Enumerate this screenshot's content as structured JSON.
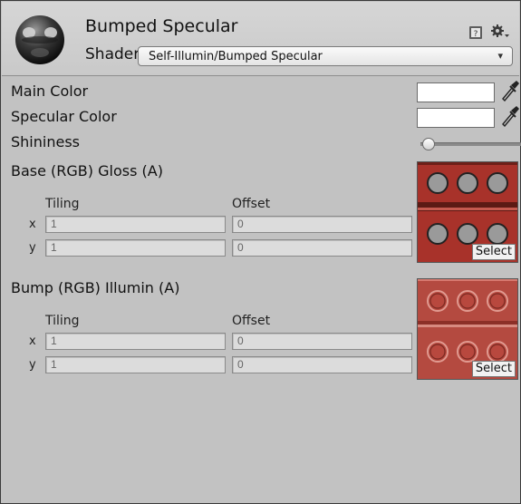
{
  "header": {
    "material_name": "Bumped Specular",
    "shader_label": "Shader",
    "shader_value": "Self-Illumin/Bumped Specular",
    "dropdown_arrow": "▾",
    "icons": [
      "material-sphere-icon",
      "help-book-icon",
      "gear-icon"
    ]
  },
  "properties": {
    "main_color": {
      "label": "Main Color",
      "value": "#ffffff"
    },
    "specular_color": {
      "label": "Specular Color",
      "value": "#ffffff"
    },
    "shininess": {
      "label": "Shininess",
      "value": 0.03
    },
    "base_texture": {
      "label": "Base (RGB) Gloss (A)",
      "tiling_label": "Tiling",
      "offset_label": "Offset",
      "x_label": "x",
      "y_label": "y",
      "tiling_x": "1",
      "tiling_y": "1",
      "offset_x": "0",
      "offset_y": "0",
      "select_label": "Select"
    },
    "bump_texture": {
      "label": "Bump (RGB) Illumin (A)",
      "tiling_label": "Tiling",
      "offset_label": "Offset",
      "x_label": "x",
      "y_label": "y",
      "tiling_x": "1",
      "tiling_y": "1",
      "offset_x": "0",
      "offset_y": "0",
      "select_label": "Select"
    }
  },
  "colors": {
    "panel_bg": "#c2c2c2",
    "header_bg": "#d0d0d0",
    "base_texture_red": "#a8322a",
    "bump_texture_red": "#b44a40"
  }
}
